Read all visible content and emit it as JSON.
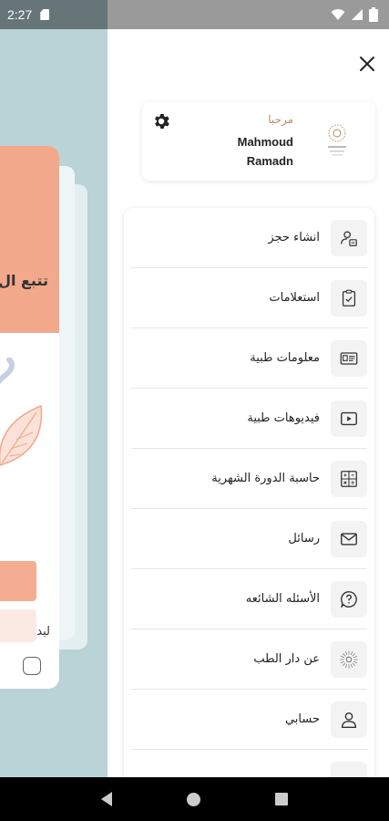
{
  "status_bar": {
    "time": "2:27"
  },
  "background_app": {
    "card_title": "تتبع ال",
    "card_label": "لبدا"
  },
  "drawer": {
    "profile": {
      "greeting": "مرحبا",
      "name_line1": "Mahmoud",
      "name_line2": "Ramadn"
    },
    "menu": [
      {
        "label": "انشاء حجز",
        "icon": "calendar-person-icon"
      },
      {
        "label": "استعلامات",
        "icon": "clipboard-check-icon"
      },
      {
        "label": "معلومات طبية",
        "icon": "id-card-icon"
      },
      {
        "label": "فيديوهات طبية",
        "icon": "video-play-icon"
      },
      {
        "label": "حاسبة الدورة الشهرية",
        "icon": "calculator-grid-icon"
      },
      {
        "label": "رسائل",
        "icon": "mail-icon"
      },
      {
        "label": "الأسئله الشائعه",
        "icon": "help-circle-icon"
      },
      {
        "label": "عن دار الطب",
        "icon": "sunburst-logo-icon"
      },
      {
        "label": "حسابي",
        "icon": "user-icon"
      }
    ]
  },
  "colors": {
    "accent_orange": "#f2a98b",
    "greeting_color": "#b48a6b",
    "backdrop": "#b9d3d7"
  }
}
